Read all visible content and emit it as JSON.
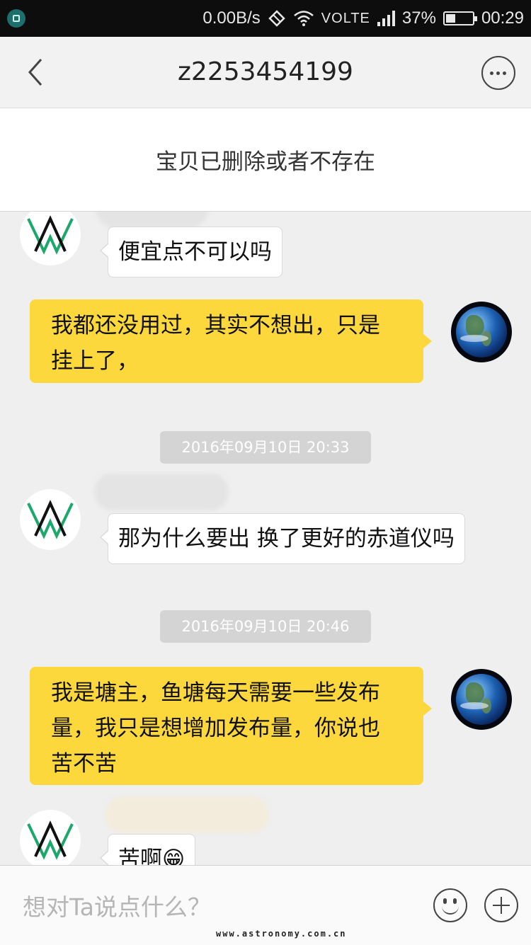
{
  "status_bar": {
    "speed": "0.00B/s",
    "network": "VOLTE",
    "battery": "37%",
    "battery_level": 0.37,
    "time": "00:29",
    "icons": [
      "app-notification-icon",
      "rotate-icon",
      "wifi-icon",
      "signal-icon",
      "battery-icon"
    ]
  },
  "header": {
    "title": "z2253454199",
    "back_icon": "chevron-left-icon",
    "more_icon": "more-dots-icon"
  },
  "notice": {
    "text": "宝贝已删除或者不存在"
  },
  "messages": [
    {
      "side": "left",
      "text": "便宜点不可以吗"
    },
    {
      "side": "right",
      "lines": [
        "我都还没用过，其实不想出，只是",
        "挂上了，"
      ]
    },
    {
      "type": "time",
      "text": "2016年09月10日 20:33"
    },
    {
      "side": "left",
      "text": "那为什么要出 换了更好的赤道仪吗"
    },
    {
      "type": "time",
      "text": "2016年09月10日 20:46"
    },
    {
      "side": "right",
      "lines": [
        "我是塘主，鱼塘每天需要一些发布",
        "量，我只是想增加发布量，你说也",
        "苦不苦"
      ]
    },
    {
      "side": "left",
      "text": "苦啊😁"
    }
  ],
  "input_bar": {
    "placeholder": "想对Ta说点什么？",
    "emoji_icon": "emoji-smile-icon",
    "plus_icon": "plus-icon"
  },
  "watermark": "www.astronomy.com.cn",
  "colors": {
    "bubble_self": "#fdd83d",
    "bubble_other": "#ffffff",
    "background": "#efefef"
  }
}
